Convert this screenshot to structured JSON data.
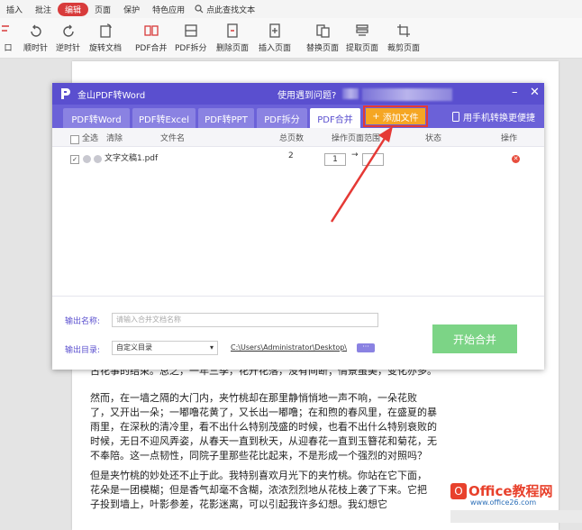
{
  "menu": {
    "items": [
      "插入",
      "批注",
      "编辑",
      "页面",
      "保护",
      "特色应用"
    ],
    "active": "编辑",
    "search_label": "点此查找文本"
  },
  "toolbar": {
    "buttons": [
      "口",
      "顺时针",
      "逆时针",
      "旋转文档",
      "PDF合并",
      "PDF拆分",
      "删除页面",
      "插入页面",
      "替换页面",
      "提取页面",
      "裁剪页面"
    ]
  },
  "dialog": {
    "title": "金山PDF转Word",
    "help": "使用遇到问题?",
    "tabs": [
      "PDF转Word",
      "PDF转Excel",
      "PDF转PPT",
      "PDF拆分",
      "PDF合并"
    ],
    "active_tab": "PDF合并",
    "add_file": "添加文件",
    "phone_link": "用手机转换更便捷",
    "table": {
      "headers": {
        "select_all": "全选",
        "clear": "清除",
        "filename": "文件名",
        "pages": "总页数",
        "range": "操作页面范围",
        "status": "状态",
        "action": "操作"
      },
      "rows": [
        {
          "name": "文字文稿1.pdf",
          "pages": "2",
          "range_from": "1",
          "range_arrow": "→",
          "range_to": ""
        }
      ]
    },
    "output_name_label": "输出名称:",
    "output_name_placeholder": "请输入合并文档名称",
    "output_dir_label": "输出目录:",
    "output_dir_option": "自定义目录",
    "output_path": "C:\\Users\\Administrator\\Desktop\\",
    "more_button": "···",
    "start_button": "开始合并"
  },
  "document": {
    "lines": [
      "古花事的结束。总之，一年三季，花开花落，没有间断；情景虽美，变化亦多。",
      "",
      "    然而，在一墙之隔的大门内，夹竹桃却在那里静悄悄地一声不响，一朵花败",
      "了，又开出一朵；一嘟噜花黄了，又长出一嘟噜；在和煦的春风里，在盛夏的暴",
      "雨里，在深秋的清冷里，看不出什么特别茂盛的时候，也看不出什么特别衰败的",
      "时候，无日不迎风弄姿，从春天一直到秋天，从迎春花一直到玉簪花和菊花，无",
      "不奉陪。这一点韧性，同院子里那些花比起来，不是形成一个强烈的对照吗？",
      "",
      "    但是夹竹桃的妙处还不止于此。我特别喜欢月光下的夹竹桃。你站在它下面，",
      "花朵是一团模糊；但是香气却毫不含糊，浓浓烈烈地从花枝上袭了下来。它把",
      "子投到墙上，叶影参差，花影迷离，可以引起我许多幻想。我幻想它"
    ]
  },
  "watermark": {
    "brand": "Office教程网",
    "url": "www.office26.com"
  }
}
